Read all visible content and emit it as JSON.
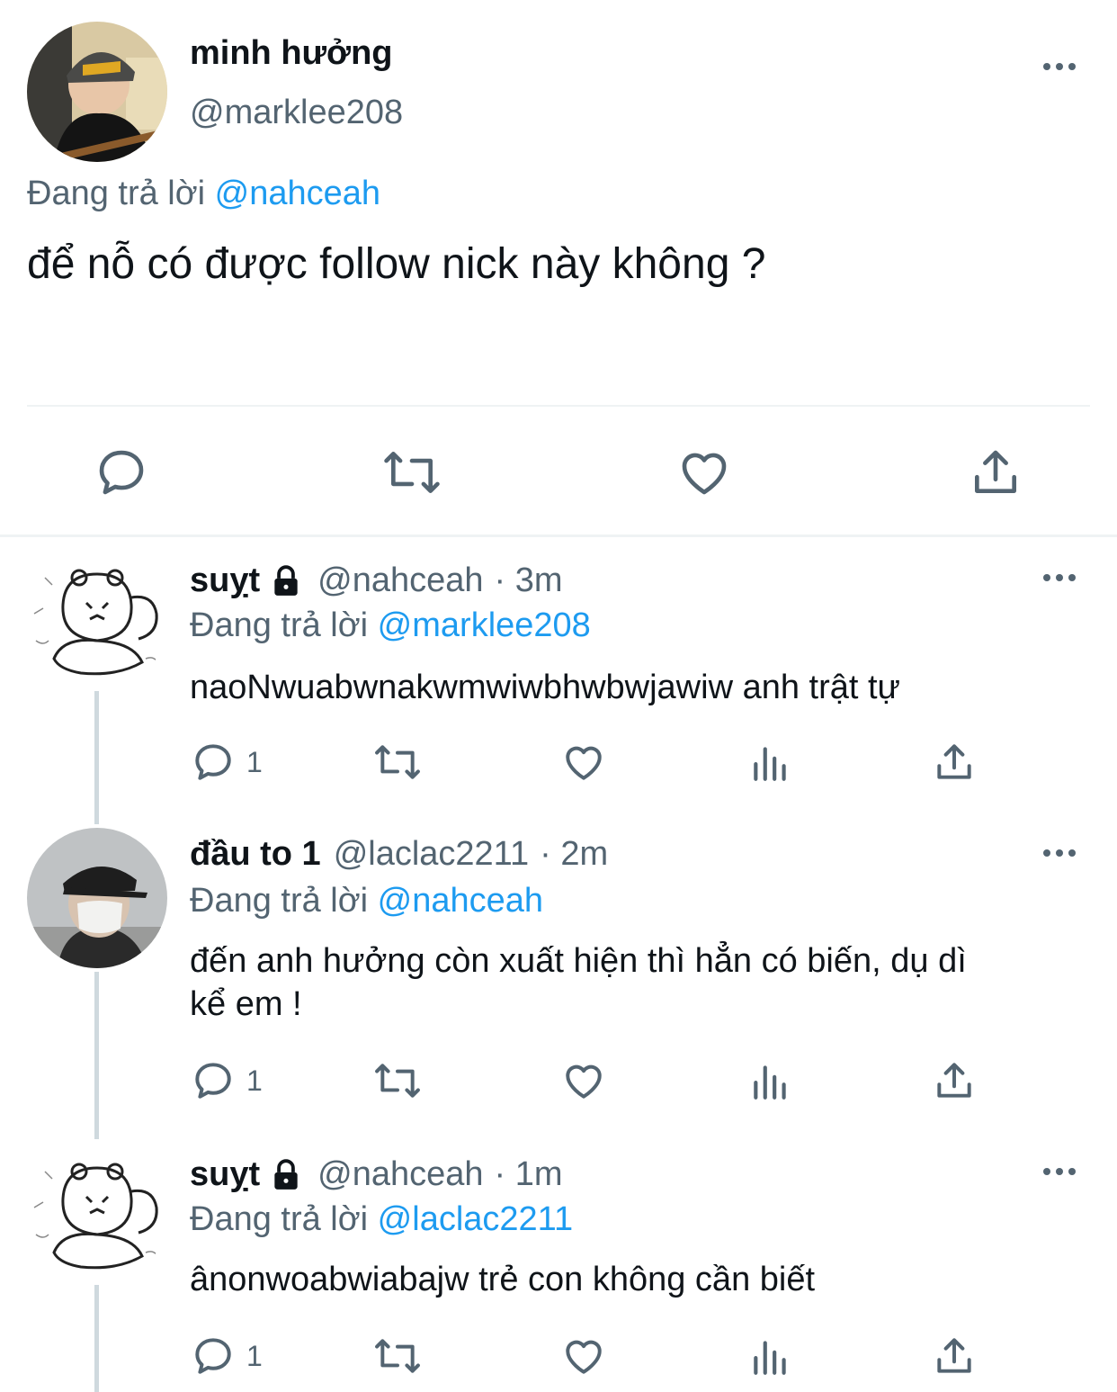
{
  "main_tweet": {
    "display_name": "minh hưởng",
    "handle": "@marklee208",
    "replying_label": "Đang trả lời",
    "replying_to": "@nahceah",
    "text": "để nỗ có được follow nick này không ?"
  },
  "replies": [
    {
      "display_name": "suỵt",
      "locked": true,
      "handle": "@nahceah",
      "time": "· 3m",
      "replying_label": "Đang trả lời",
      "replying_to": "@marklee208",
      "text_lines": [
        "naoNwuabwnakwmwiwbhwbwjawiw anh trật tự"
      ],
      "reply_count": "1"
    },
    {
      "display_name": "đầu to 1",
      "locked": false,
      "handle": "@laclac2211",
      "time": "· 2m",
      "replying_label": "Đang trả lời",
      "replying_to": "@nahceah",
      "text_lines": [
        "đến anh hưởng còn xuất hiện thì hẳn có biến, dụ dì",
        "kể em !"
      ],
      "reply_count": "1"
    },
    {
      "display_name": "suỵt",
      "locked": true,
      "handle": "@nahceah",
      "time": "· 1m",
      "replying_label": "Đang trả lời",
      "replying_to": "@laclac2211",
      "text_lines": [
        "ânonwoabwiabajw trẻ con không cần biết"
      ],
      "reply_count": "1"
    }
  ],
  "icons": {
    "more": "more-dots-icon",
    "reply": "reply-icon",
    "retweet": "retweet-icon",
    "like": "like-heart-icon",
    "views": "views-chart-icon",
    "share": "share-icon",
    "lock": "lock-icon"
  },
  "colors": {
    "text": "#0f1419",
    "secondary": "#536471",
    "link": "#1d9bf0",
    "divider": "#eff3f4"
  }
}
